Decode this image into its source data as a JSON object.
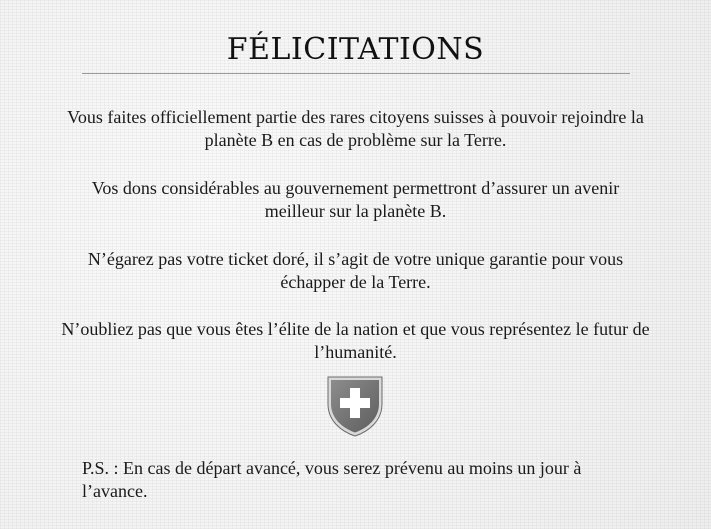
{
  "document": {
    "title": "FÉLICITATIONS",
    "paragraphs": [
      "Vous faites officiellement partie des rares citoyens suisses à pouvoir rejoindre la planète B en cas de problème sur la Terre.",
      "Vos dons considérables au gouvernement permettront d’assurer un avenir meilleur sur la planète B.",
      "N’égarez pas votre ticket doré, il s’agit de votre unique garantie pour vous échapper de la Terre.",
      "N’oubliez pas que vous êtes l’élite de la nation et que vous représentez le futur de l’humanité."
    ],
    "postscript": "P.S. : En cas de départ avancé, vous serez prévenu au moins un jour à l’avance."
  },
  "emblem": {
    "icon": "swiss-coat-of-arms-icon",
    "shield_color": "#7a7a7a",
    "cross_color": "#ffffff"
  }
}
